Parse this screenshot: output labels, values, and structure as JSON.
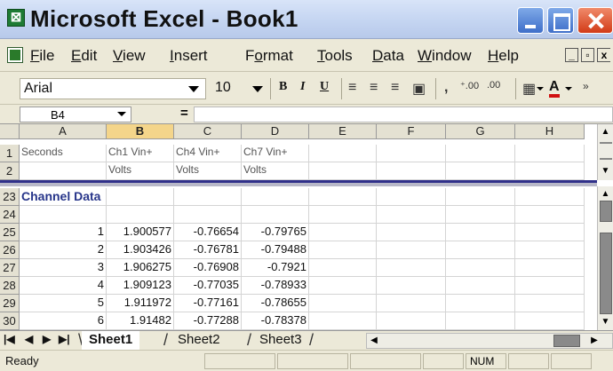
{
  "window": {
    "icon_glyph": "⊠",
    "title": "Microsoft Excel - Book1"
  },
  "menu": {
    "items": [
      {
        "prefix": "",
        "u": "F",
        "rest": "ile"
      },
      {
        "prefix": "",
        "u": "E",
        "rest": "dit"
      },
      {
        "prefix": "",
        "u": "V",
        "rest": "iew"
      },
      {
        "prefix": "",
        "u": "I",
        "rest": "nsert"
      },
      {
        "prefix": "F",
        "u": "o",
        "rest": "rmat"
      },
      {
        "prefix": "",
        "u": "T",
        "rest": "ools"
      },
      {
        "prefix": "",
        "u": "D",
        "rest": "ata"
      },
      {
        "prefix": "",
        "u": "W",
        "rest": "indow"
      },
      {
        "prefix": "",
        "u": "H",
        "rest": "elp"
      }
    ],
    "mdi_min": "_",
    "mdi_restore": "▫",
    "mdi_close": "x"
  },
  "toolbar": {
    "font_name": "Arial",
    "font_size": "10",
    "bold": "B",
    "italic": "I",
    "underline": "U",
    "comma_style": ",",
    "inc_decimal": "⁺.00",
    "dec_decimal": ".00",
    "fill_color_glyph": "▦",
    "font_color_glyph": "A"
  },
  "formula_bar": {
    "name_box": "B4",
    "equals": "=",
    "formula": ""
  },
  "sheet": {
    "columns": [
      "A",
      "B",
      "C",
      "D",
      "E",
      "F",
      "G",
      "H"
    ],
    "active_column": "B",
    "top_rows": [
      {
        "num": "1",
        "cells": [
          "Seconds",
          "Ch1 Vin+",
          "Ch4 Vin+",
          "Ch7 Vin+",
          "",
          "",
          "",
          ""
        ]
      },
      {
        "num": "2",
        "cells": [
          "",
          "Volts",
          "Volts",
          "Volts",
          "",
          "",
          "",
          ""
        ]
      }
    ],
    "bottom_rows": [
      {
        "num": "23",
        "cells": [
          "Channel Data",
          "",
          "",
          "",
          "",
          "",
          "",
          ""
        ]
      },
      {
        "num": "24",
        "cells": [
          "",
          "",
          "",
          "",
          "",
          "",
          "",
          ""
        ]
      },
      {
        "num": "25",
        "cells": [
          "1",
          "1.900577",
          "-0.76654",
          "-0.79765",
          "",
          "",
          "",
          ""
        ]
      },
      {
        "num": "26",
        "cells": [
          "2",
          "1.903426",
          "-0.76781",
          "-0.79488",
          "",
          "",
          "",
          ""
        ]
      },
      {
        "num": "27",
        "cells": [
          "3",
          "1.906275",
          "-0.76908",
          "-0.7921",
          "",
          "",
          "",
          ""
        ]
      },
      {
        "num": "28",
        "cells": [
          "4",
          "1.909123",
          "-0.77035",
          "-0.78933",
          "",
          "",
          "",
          ""
        ]
      },
      {
        "num": "29",
        "cells": [
          "5",
          "1.911972",
          "-0.77161",
          "-0.78655",
          "",
          "",
          "",
          ""
        ]
      },
      {
        "num": "30",
        "cells": [
          "6",
          "1.91482",
          "-0.77288",
          "-0.78378",
          "",
          "",
          "",
          ""
        ]
      }
    ]
  },
  "tabs": {
    "nav_first": "|◀",
    "nav_prev": "◀",
    "nav_next": "▶",
    "nav_last": "▶|",
    "sheets": [
      "Sheet1",
      "Sheet2",
      "Sheet3"
    ],
    "active": "Sheet1"
  },
  "status": {
    "text": "Ready",
    "num_indicator": "NUM"
  }
}
